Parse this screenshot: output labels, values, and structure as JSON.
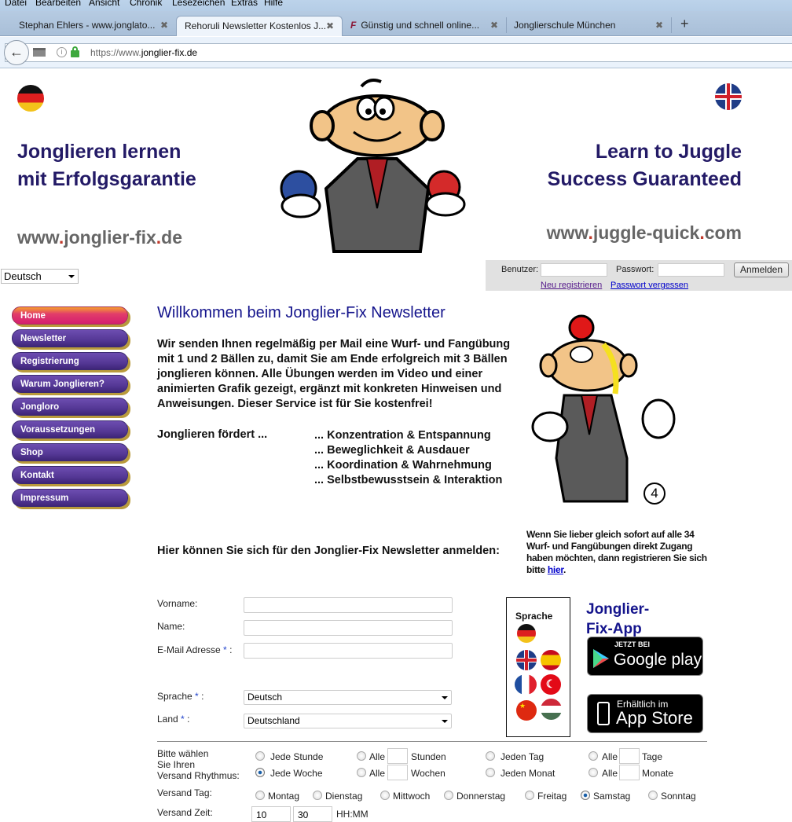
{
  "browser": {
    "menu": [
      "Datei",
      "Bearbeiten",
      "Ansicht",
      "Chronik",
      "Lesezeichen",
      "Extras",
      "Hilfe"
    ],
    "tabs": [
      {
        "label": "Stephan Ehlers - www.jonglato...",
        "active": false
      },
      {
        "label": "Rehoruli Newsletter Kostenlos J...",
        "active": true
      },
      {
        "label": "Günstig und schnell online...",
        "active": false,
        "icon": "F"
      },
      {
        "label": "Jonglierschule München",
        "active": false
      }
    ],
    "new_tab": "+",
    "close_glyph": "✖",
    "url_prefix": "https://www.",
    "url_domain": "jonglier-fix.de"
  },
  "header": {
    "de_title_1": "Jonglieren lernen",
    "de_title_2": "mit Erfolgsgarantie",
    "de_url_a": "www",
    "de_url_b": "jonglier-fix",
    "de_url_c": "de",
    "en_title_1": "Learn to Juggle",
    "en_title_2": "Success Guaranteed",
    "en_url_a": "www",
    "en_url_b": "juggle-quick",
    "en_url_c": "com",
    "dot": "."
  },
  "language_select": "Deutsch",
  "login": {
    "user_label": "Benutzer:",
    "password_label": "Passwort:",
    "submit": "Anmelden",
    "register_link": "Neu registrieren",
    "forgot_link": "Passwort vergessen",
    "link_visited_color": "#551a8b",
    "link_color": "#0000cc"
  },
  "nav": [
    {
      "label": "Home",
      "active": true
    },
    {
      "label": "Newsletter"
    },
    {
      "label": "Registrierung"
    },
    {
      "label": "Warum Jonglieren?"
    },
    {
      "label": "Jongloro"
    },
    {
      "label": "Voraussetzungen"
    },
    {
      "label": "Shop"
    },
    {
      "label": "Kontakt"
    },
    {
      "label": "Impressum"
    }
  ],
  "main": {
    "title": "Willkommen beim Jonglier-Fix Newsletter",
    "intro": "Wir senden Ihnen regelmäßig per Mail eine Wurf- und Fangübung mit 1 und 2 Bällen zu, damit Sie am Ende erfolgreich mit 3 Bällen jonglieren können. Alle Übungen werden im Video und einer animierten Grafik gezeigt, ergänzt mit konkreten Hinweisen und Anweisungen. Dieser Service ist für Sie kostenfrei!",
    "foerdert_label": "Jonglieren fördert ...",
    "foerdert": [
      "... Konzentration & Entspannung",
      "... Beweglichkeit & Ausdauer",
      "... Koordination & Wahrnehmung",
      "... Selbstbewusstsein & Interaktion"
    ],
    "illustration_number": "4",
    "signup_heading": "Hier können Sie sich für den Jonglier-Fix Newsletter anmelden:",
    "register_hint": "Wenn Sie lieber gleich sofort auf alle 34 Wurf- und Fangübungen direkt Zugang haben möchten, dann registrieren Sie sich bitte ",
    "register_hint_link": "hier",
    "register_hint_end": "."
  },
  "form": {
    "vorname": "Vorname:",
    "name": "Name:",
    "email": "E-Mail Adresse",
    "sprache": "Sprache",
    "land": "Land",
    "req": "*",
    "colon": ":",
    "sprache_value": "Deutsch",
    "land_value": "Deutschland",
    "rhythmus_label_1": "Bitte wählen",
    "rhythmus_label_2": "Sie Ihren",
    "rhythmus_label_3": "Versand Rhythmus:",
    "rhythmus": [
      {
        "label": "Jede Stunde",
        "checked": false
      },
      {
        "label": "Alle",
        "unit": "Stunden",
        "checked": false
      },
      {
        "label": "Jeden Tag",
        "checked": false
      },
      {
        "label": "Alle",
        "unit": "Tage",
        "checked": false
      },
      {
        "label": "Jede Woche",
        "checked": true
      },
      {
        "label": "Alle",
        "unit": "Wochen",
        "checked": false
      },
      {
        "label": "Jeden Monat",
        "checked": false
      },
      {
        "label": "Alle",
        "unit": "Monate",
        "checked": false
      }
    ],
    "tag_label": "Versand Tag:",
    "tage": [
      {
        "label": "Montag",
        "checked": false
      },
      {
        "label": "Dienstag",
        "checked": false
      },
      {
        "label": "Mittwoch",
        "checked": false
      },
      {
        "label": "Donnerstag",
        "checked": false
      },
      {
        "label": "Freitag",
        "checked": false
      },
      {
        "label": "Samstag",
        "checked": true
      },
      {
        "label": "Sonntag",
        "checked": false
      }
    ],
    "zeit_label": "Versand Zeit:",
    "zeit_hh": "10",
    "zeit_mm": "30",
    "zeit_format": "HH:MM"
  },
  "side": {
    "lang_title": "Sprache",
    "app_title_1": "Jonglier-",
    "app_title_2": "Fix-App",
    "google_small": "JETZT BEI",
    "google_big": "Google play",
    "apple_small": "Erhältlich im",
    "apple_big": "App Store"
  }
}
